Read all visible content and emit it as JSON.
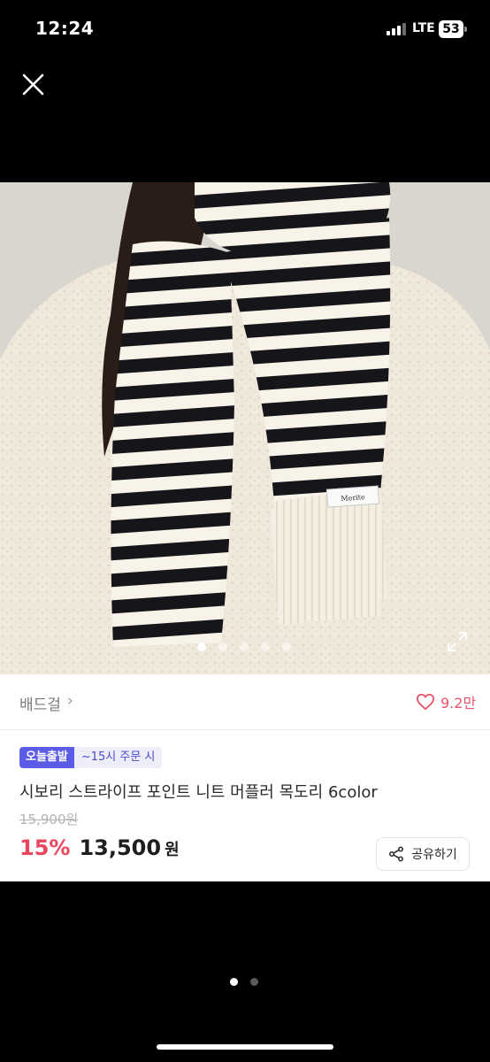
{
  "status_bar": {
    "time": "12:24",
    "network": "LTE",
    "battery": "53"
  },
  "product": {
    "image_alt": "striped knit muffler",
    "tag_text": "Merite",
    "carousel": {
      "count": 5,
      "active_index": 0
    },
    "shop_name": "배드걸",
    "likes": "9.2만",
    "badge_today": "오늘출발",
    "badge_cutoff": "~15시 주문 시",
    "title": "시보리 스트라이프 포인트 니트 머플러 목도리 6color",
    "original_price": "15,900원",
    "discount": "15%",
    "sale_price": "13,500",
    "currency": "원",
    "share_label": "공유하기"
  },
  "pager": {
    "count": 2,
    "active_index": 0
  },
  "colors": {
    "accent_pink": "#e8475f",
    "badge_purple": "#5a5ce6"
  }
}
